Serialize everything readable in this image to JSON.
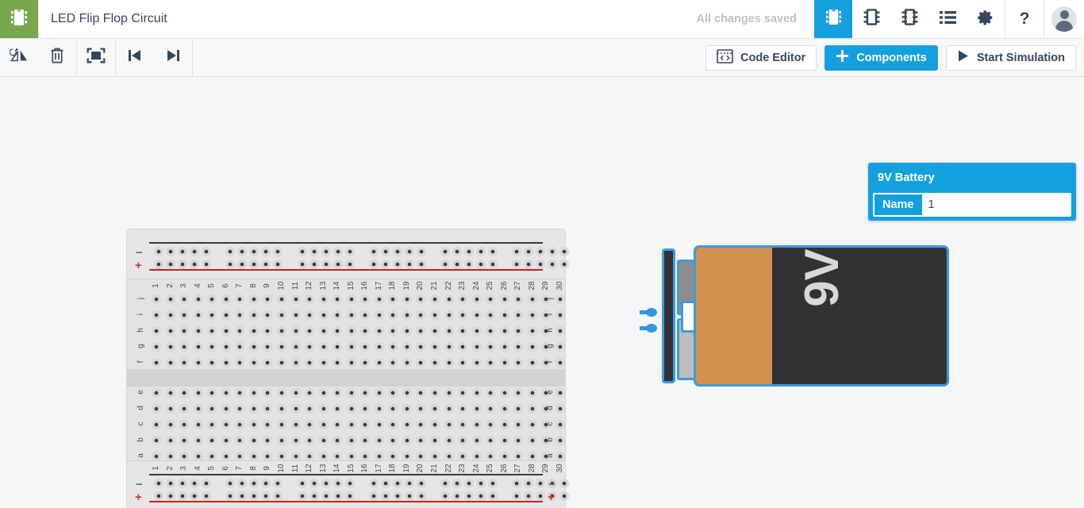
{
  "header": {
    "logo_icon": "chip-logo-icon",
    "title": "LED Flip Flop Circuit",
    "save_status": "All changes saved",
    "view_buttons": [
      {
        "name": "breadboard-view",
        "icon": "breadboard-icon",
        "active": true
      },
      {
        "name": "schematic-view",
        "icon": "schematic-chip-icon",
        "active": false
      },
      {
        "name": "pcb-view",
        "icon": "pcb-chip-icon",
        "active": false
      },
      {
        "name": "components-list-view",
        "icon": "list-icon",
        "active": false
      },
      {
        "name": "settings",
        "icon": "gear-icon",
        "active": false
      }
    ],
    "help_label": "?",
    "avatar_label": "user-avatar"
  },
  "toolbar": {
    "left_buttons": [
      {
        "name": "rotate-flip-button",
        "icon": "rotate-flip-icon"
      },
      {
        "name": "delete-button",
        "icon": "trash-icon"
      },
      {
        "name": "fit-to-screen-button",
        "icon": "fit-screen-icon"
      },
      {
        "name": "step-back-button",
        "icon": "step-backward-icon"
      },
      {
        "name": "step-forward-button",
        "icon": "step-forward-icon"
      }
    ],
    "code_editor_label": "Code Editor",
    "components_label": "Components",
    "start_simulation_label": "Start Simulation"
  },
  "properties": {
    "title": "9V Battery",
    "name_label": "Name",
    "name_value": "1",
    "name_placeholder": ""
  },
  "battery": {
    "voltage_label": "9V",
    "body_color": "#323234",
    "band_color": "#d2914f",
    "outline_color": "#3d9ae0"
  },
  "breadboard": {
    "columns": [
      1,
      2,
      3,
      4,
      5,
      6,
      7,
      8,
      9,
      10,
      11,
      12,
      13,
      14,
      15,
      16,
      17,
      18,
      19,
      20,
      21,
      22,
      23,
      24,
      25,
      26,
      27,
      28,
      29,
      30
    ],
    "upper_rows": [
      "j",
      "i",
      "h",
      "g",
      "f"
    ],
    "lower_rows": [
      "e",
      "d",
      "c",
      "b",
      "a"
    ],
    "rail_plus": "+",
    "rail_minus": "−"
  },
  "colors": {
    "accent": "#14a0de",
    "logo_green": "#79a64e",
    "text_dark": "#37475b",
    "canvas_bg": "#f5f6f7",
    "rail_red": "#d0201b"
  }
}
